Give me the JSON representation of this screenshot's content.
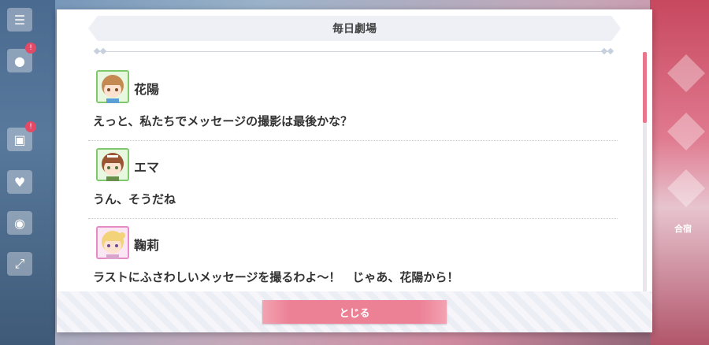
{
  "dialog": {
    "title": "毎日劇場",
    "close_label": "とじる"
  },
  "entries": [
    {
      "name": "花陽",
      "avatar_icon": "hanayo-avatar-icon",
      "avatar_bg": "#7dc96b",
      "hair": "#c48a52",
      "line": "えっと、私たちでメッセージの撮影は最後かな？"
    },
    {
      "name": "エマ",
      "avatar_icon": "emma-avatar-icon",
      "avatar_bg": "#7dc96b",
      "hair": "#9a5533",
      "line": "うん、そうだね"
    },
    {
      "name": "鞠莉",
      "avatar_icon": "mari-avatar-icon",
      "avatar_bg": "#e889c8",
      "hair": "#f2d37a",
      "line": "ラストにふさわしいメッセージを撮るわよ～！　じゃあ、花陽から！"
    }
  ],
  "background": {
    "left_badges": [
      "!",
      "!"
    ],
    "right_label": "合宿"
  },
  "colors": {
    "accent": "#ec8095",
    "scroll_thumb": "#e8778d"
  }
}
